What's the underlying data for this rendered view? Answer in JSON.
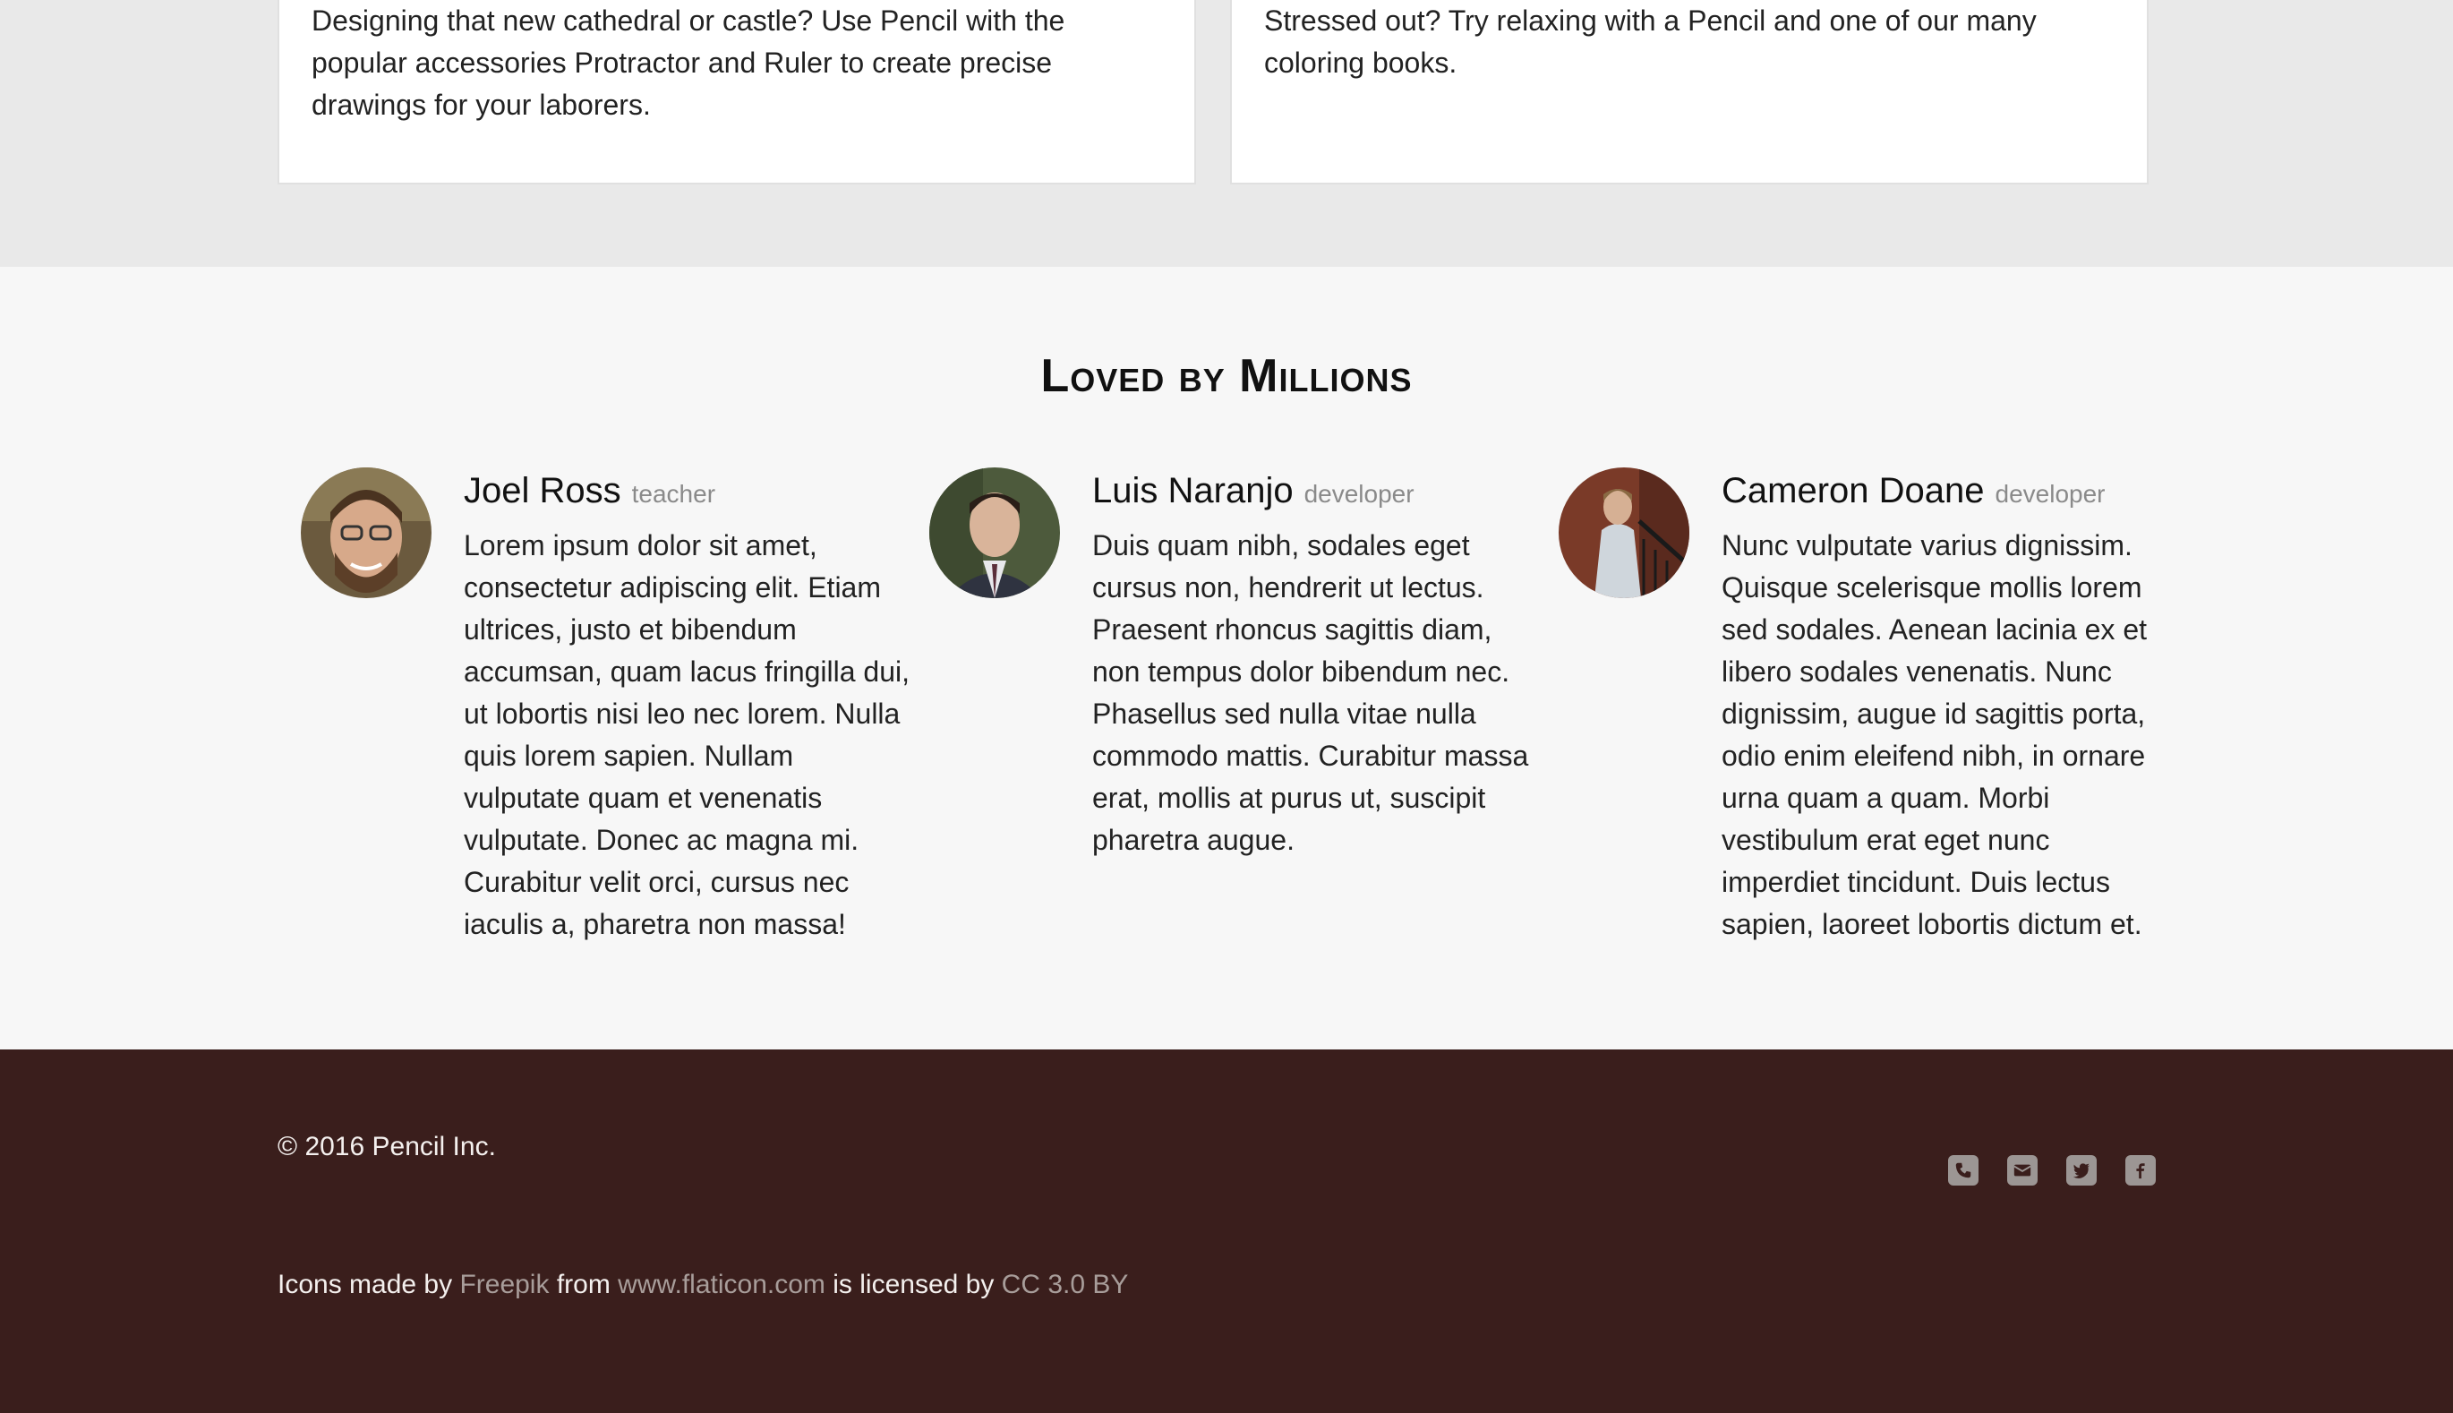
{
  "features": {
    "card_1_text": "Designing that new cathedral or castle? Use Pencil with the popular accessories Protractor and Ruler to create precise drawings for your laborers.",
    "card_2_text": "Stressed out? Try relaxing with a Pencil and one of our many coloring books."
  },
  "testimonials": {
    "title": "Loved by Millions",
    "people": [
      {
        "name": "Joel Ross",
        "role": "teacher",
        "text": "Lorem ipsum dolor sit amet, consectetur adipiscing elit. Etiam ultrices, justo et bibendum accumsan, quam lacus fringilla dui, ut lobortis nisi leo nec lorem. Nulla quis lorem sapien. Nullam vulputate quam et venenatis vulputate. Donec ac magna mi. Curabitur velit orci, cursus nec iaculis a, pharetra non massa!"
      },
      {
        "name": "Luis Naranjo",
        "role": "developer",
        "text": "Duis quam nibh, sodales eget cursus non, hendrerit ut lectus. Praesent rhoncus sagittis diam, non tempus dolor bibendum nec. Phasellus sed nulla vitae nulla commodo mattis. Curabitur massa erat, mollis at purus ut, suscipit pharetra augue."
      },
      {
        "name": "Cameron Doane",
        "role": "developer",
        "text": "Nunc vulputate varius dignissim. Quisque scelerisque mollis lorem sed sodales. Aenean lacinia ex et libero sodales venenatis. Nunc dignissim, augue id sagittis porta, odio enim eleifend nibh, in ornare urna quam a quam. Morbi vestibulum erat eget nunc imperdiet tincidunt. Duis lectus sapien, laoreet lobortis dictum et."
      }
    ]
  },
  "footer": {
    "copyright": "© 2016 Pencil Inc.",
    "social_icons": [
      "phone-icon",
      "mail-icon",
      "twitter-icon",
      "facebook-icon"
    ],
    "credits": {
      "t1": "Icons made by ",
      "link1": "Freepik",
      "t2": " from ",
      "link2": "www.flaticon.com",
      "t3": " is licensed by ",
      "link3": "CC 3.0 BY"
    }
  },
  "colors": {
    "footer_bg": "#3a1e1c",
    "section_bg": "#f7f7f7",
    "band_bg": "#e9e9e9"
  }
}
